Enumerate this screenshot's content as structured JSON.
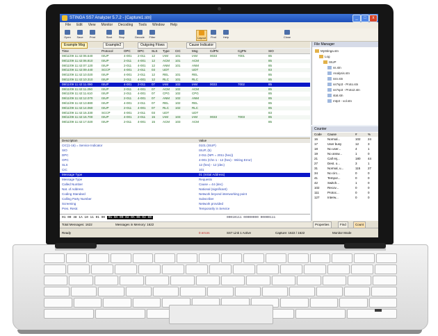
{
  "window": {
    "title": "STINGA SS7 Analyzer 5.7.2 - [Capture1.stn]",
    "buttons": {
      "minimize": "_",
      "maximize": "□",
      "close": "x"
    }
  },
  "menu": [
    "File",
    "Edit",
    "View",
    "Monitor",
    "Decoding",
    "Tools",
    "Window",
    "Help"
  ],
  "toolbar": [
    "Open",
    "Save",
    "Print",
    "Start",
    "Stop",
    "Decode",
    "Filter",
    "Layout",
    "Find",
    "Help",
    "Close"
  ],
  "filter_tabs": [
    "Example Msg",
    "Example2",
    "Outgoing Flows",
    "Cause Indicator"
  ],
  "grid": {
    "columns": [
      "Time",
      "Protocol",
      "OPC",
      "DPC",
      "SLS",
      "Type",
      "CIC",
      "Msg",
      "CdPN",
      "CgPN",
      "SIO"
    ],
    "rows": [
      [
        "08/11/09 11:42:06.640",
        "ISUP",
        "4-001",
        "2-011",
        "12",
        "IAM",
        "101",
        "IAM",
        "0033",
        "7001",
        "85"
      ],
      [
        "08/11/09 11:42:06.810",
        "ISUP",
        "2-011",
        "4-001",
        "12",
        "ACM",
        "101",
        "ACM",
        "",
        "",
        "85"
      ],
      [
        "08/11/09 11:42:07.120",
        "ISUP",
        "2-011",
        "4-001",
        "12",
        "ANM",
        "101",
        "ANM",
        "",
        "",
        "85"
      ],
      [
        "08/11/09 11:42:09.440",
        "SCCP",
        "4-001",
        "2-011",
        "03",
        "UDT",
        "",
        "UDT",
        "",
        "",
        "83"
      ],
      [
        "08/11/09 11:42:10.020",
        "ISUP",
        "4-001",
        "2-011",
        "12",
        "REL",
        "101",
        "REL",
        "",
        "",
        "85"
      ],
      [
        "08/11/09 11:42:10.310",
        "ISUP",
        "2-011",
        "4-001",
        "12",
        "RLC",
        "101",
        "RLC",
        "",
        "",
        "85"
      ],
      [
        "08/11/09 11:42:11.090",
        "ISUP",
        "4-001",
        "2-011",
        "07",
        "IAM",
        "102",
        "IAM",
        "0033",
        "7002",
        "85"
      ],
      [
        "08/11/09 11:42:11.250",
        "ISUP",
        "2-011",
        "4-001",
        "07",
        "ACM",
        "102",
        "ACM",
        "",
        "",
        "85"
      ],
      [
        "08/11/09 11:42:11.610",
        "ISUP",
        "2-011",
        "4-001",
        "07",
        "CPG",
        "102",
        "CPG",
        "",
        "",
        "85"
      ],
      [
        "08/11/09 11:42:12.070",
        "ISUP",
        "2-011",
        "4-001",
        "07",
        "ANM",
        "102",
        "ANM",
        "",
        "",
        "85"
      ],
      [
        "08/11/09 11:42:13.880",
        "ISUP",
        "4-001",
        "2-011",
        "07",
        "REL",
        "102",
        "REL",
        "",
        "",
        "85"
      ],
      [
        "08/11/09 11:42:14.060",
        "ISUP",
        "2-011",
        "4-001",
        "07",
        "RLC",
        "102",
        "RLC",
        "",
        "",
        "85"
      ],
      [
        "08/11/09 11:42:15.330",
        "SCCP",
        "4-001",
        "2-011",
        "03",
        "UDT",
        "",
        "UDT",
        "",
        "",
        "83"
      ],
      [
        "08/11/09 11:42:16.700",
        "ISUP",
        "4-001",
        "2-011",
        "15",
        "IAM",
        "103",
        "IAM",
        "0033",
        "7003",
        "85"
      ],
      [
        "08/11/09 11:42:17.020",
        "ISUP",
        "2-011",
        "4-001",
        "15",
        "ACM",
        "103",
        "ACM",
        "",
        "",
        "85"
      ]
    ],
    "selected_row": 6
  },
  "detail": {
    "columns": [
      "Description",
      "Value"
    ],
    "lines": [
      [
        "  CIC(1-16) = Service Indicator",
        "0101 (ISUP)"
      ],
      [
        "    SIO",
        "ISUP, (5)"
      ],
      [
        "    DPC",
        "2-011 (NPI = 2011 (hex))"
      ],
      [
        "    OPC",
        "4-001 (Chn 1 - 12 (hex) - Wiring Error)"
      ],
      [
        "    SLS",
        "12 (hex) - 12 (dec)"
      ],
      [
        "    CIC",
        "101"
      ],
      [
        "  Message Type",
        "01 (Initial Address)"
      ],
      [
        "    Message Type",
        "Requests"
      ],
      [
        "  Called Number",
        "Cause = 44 (dec)"
      ],
      [
        "    Nat. of Address",
        "National (significant)"
      ],
      [
        "    Coding Standard",
        "Network beyond interworking point"
      ],
      [
        "  Calling Party Number",
        "Subscriber"
      ],
      [
        "    Screening",
        "Network provided"
      ],
      [
        "    Pres. Restr.",
        "Temporarily in Service"
      ]
    ],
    "selected_line": 6
  },
  "hex": {
    "prefix": "01 00 48 1A 10 11 01 00",
    "selected": "01 0A 00 02 0A 06 02 60",
    "right": "00010111 00000000 00000111"
  },
  "status_row": {
    "total": "Total Messages: 1622",
    "memory": "Messages in Memory: 1622"
  },
  "statusbar": {
    "ready": "Ready",
    "errors": "0 errors",
    "link": "SS7 Link 1 Active",
    "capture": "Capture: 1622 / 1622",
    "mode": "Monitor Mode"
  },
  "file_manager": {
    "title": "File Manager",
    "nodes": [
      "MyStinga.stn",
      "Log",
      "ISUP",
      "ss.stn",
      "Analysis.stn",
      "ssn.stn",
      "ss7sp3 - Proto.stn",
      "ss7sp3 - Proto2.stn",
      "stat.stn",
      "mtp3 - vol.stn"
    ]
  },
  "counter": {
    "title": "Counter",
    "columns": [
      "Code",
      "Cause",
      "#",
      "%"
    ],
    "rows": [
      [
        "16",
        "Normal...",
        "102",
        "24"
      ],
      [
        "17",
        "User busy",
        "12",
        "3"
      ],
      [
        "18",
        "No user...",
        "4",
        "1"
      ],
      [
        "19",
        "No answ...",
        "1",
        "0"
      ],
      [
        "21",
        "Call rej...",
        "180",
        "44"
      ],
      [
        "27",
        "Dest. o...",
        "3",
        "1"
      ],
      [
        "31",
        "Normal, u...",
        "115",
        "27"
      ],
      [
        "34",
        "No circ...",
        "0",
        "0"
      ],
      [
        "41",
        "Tempor...",
        "0",
        "0"
      ],
      [
        "42",
        "Switch...",
        "1",
        "0"
      ],
      [
        "102",
        "Recov...",
        "0",
        "0"
      ],
      [
        "111",
        "Protoc...",
        "0",
        "0"
      ],
      [
        "127",
        "Interw...",
        "0",
        "0"
      ]
    ]
  },
  "bottom_tabs": [
    "Properties",
    "Find",
    "Count"
  ],
  "laptop": {
    "brand": "ultrabook"
  }
}
